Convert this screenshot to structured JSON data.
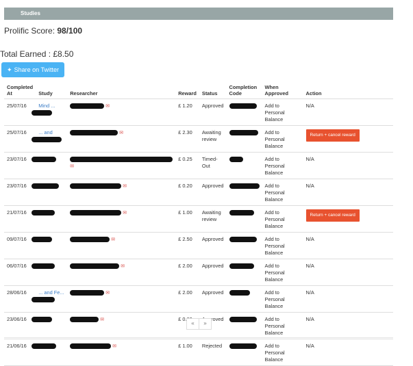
{
  "panel": {
    "title": "Studies"
  },
  "score": {
    "label": "Prolific Score: ",
    "value": "98/100"
  },
  "earned": {
    "text": "Total Earned : £8.50"
  },
  "share": {
    "label": "Share on Twitter",
    "icon": "twitter-bird-icon"
  },
  "table": {
    "headers": [
      "Completed At",
      "Study",
      "Researcher",
      "Reward",
      "Status",
      "Completion Code",
      "When Approved",
      "Action"
    ],
    "rows": [
      {
        "date": "25/07/16",
        "study": "Mind ...",
        "reward": "£ 1.20",
        "status": "Approved",
        "when": "Add to Personal Balance",
        "action": "N/A"
      },
      {
        "date": "25/07/16",
        "study": "... and",
        "reward": "£ 2.30",
        "status": "Awaiting review",
        "when": "Add to Personal Balance",
        "action": "Return + cancel reward"
      },
      {
        "date": "23/07/16",
        "study": "",
        "reward": "£ 0.25",
        "status": "Timed-Out",
        "when": "Add to Personal Balance",
        "action": "N/A"
      },
      {
        "date": "23/07/16",
        "study": "",
        "reward": "£ 0.20",
        "status": "Approved",
        "when": "Add to Personal Balance",
        "action": "N/A"
      },
      {
        "date": "21/07/16",
        "study": "",
        "reward": "£ 1.00",
        "status": "Awaiting review",
        "when": "Add to Personal Balance",
        "action": "Return + cancel reward"
      },
      {
        "date": "09/07/16",
        "study": "",
        "reward": "£ 2.50",
        "status": "Approved",
        "when": "Add to Personal Balance",
        "action": "N/A"
      },
      {
        "date": "06/07/16",
        "study": "",
        "reward": "£ 2.00",
        "status": "Approved",
        "when": "Add to Personal Balance",
        "action": "N/A"
      },
      {
        "date": "28/06/16",
        "study": "... and Fe...",
        "reward": "£ 2.00",
        "status": "Approved",
        "when": "Add to Personal Balance",
        "action": "N/A"
      },
      {
        "date": "23/06/16",
        "study": "",
        "reward": "£ 0.60",
        "status": "Approved",
        "when": "Add to Personal Balance",
        "action": "N/A"
      },
      {
        "date": "21/06/16",
        "study": "",
        "reward": "£ 1.00",
        "status": "Rejected",
        "when": "Add to Personal Balance",
        "action": "N/A"
      }
    ]
  },
  "pager": {
    "prev": "«",
    "next": "»"
  }
}
